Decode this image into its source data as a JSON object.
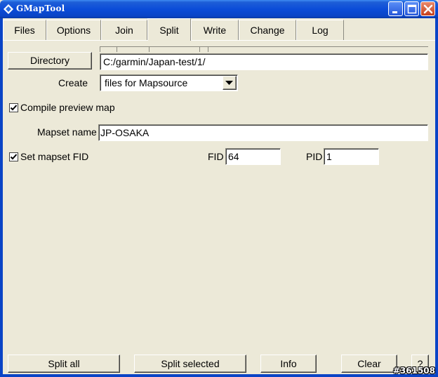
{
  "window": {
    "title": "GMapTool"
  },
  "tabs": [
    {
      "label": "Files"
    },
    {
      "label": "Options"
    },
    {
      "label": "Join"
    },
    {
      "label": "Split",
      "active": true
    },
    {
      "label": "Write"
    },
    {
      "label": "Change"
    },
    {
      "label": "Log"
    }
  ],
  "split": {
    "directory_button": "Directory",
    "directory_value": "C:/garmin/Japan-test/1/",
    "create_label": "Create",
    "create_value": "files for Mapsource",
    "compile_preview_label": "Compile preview map",
    "compile_preview_checked": true,
    "mapset_name_label": "Mapset name",
    "mapset_name_value": "JP-OSAKA",
    "set_fid_label": "Set mapset FID",
    "set_fid_checked": true,
    "fid_label": "FID",
    "fid_value": "64",
    "pid_label": "PID",
    "pid_value": "1"
  },
  "footer": {
    "split_all": "Split all",
    "split_selected": "Split selected",
    "info": "Info",
    "clear": "Clear",
    "help": "?"
  },
  "watermark": "#361508",
  "icons": {
    "app": "gmaptool-diamond-icon",
    "minimize": "minimize-icon",
    "maximize": "maximize-icon",
    "close": "close-icon",
    "dropdown": "triangle-down-icon",
    "check": "checkmark-icon"
  }
}
